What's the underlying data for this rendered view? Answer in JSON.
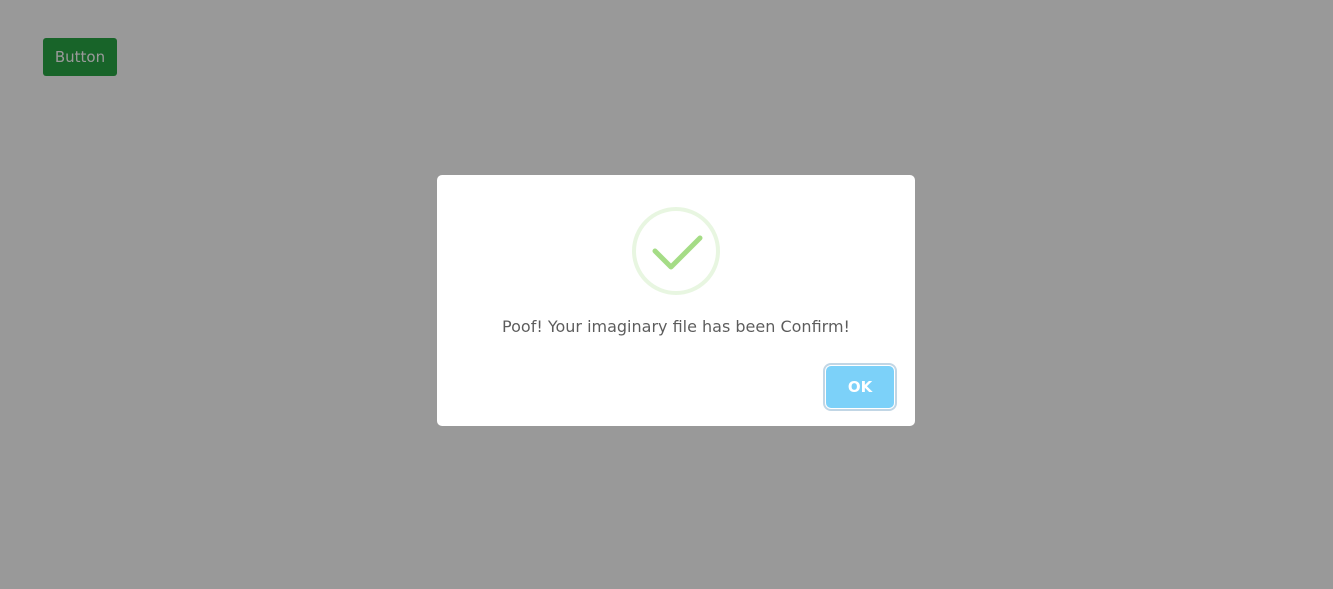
{
  "page": {
    "button_label": "Button",
    "button_color": "#28a745"
  },
  "overlay": {
    "color": "rgba(0,0,0,0.4)"
  },
  "dialog": {
    "icon": "success-check-icon",
    "icon_color": "#a5dc86",
    "text": "Poof! Your imaginary file has been Confirm!",
    "confirm_label": "OK",
    "confirm_color": "#7cd1f9"
  }
}
